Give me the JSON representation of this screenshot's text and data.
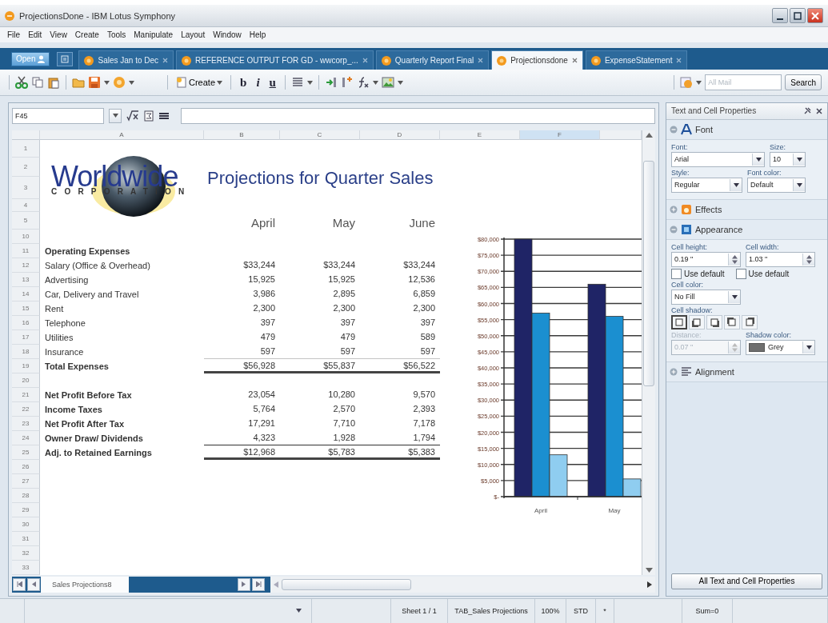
{
  "window": {
    "title": "ProjectionsDone - IBM Lotus Symphony"
  },
  "menu": [
    "File",
    "Edit",
    "View",
    "Create",
    "Tools",
    "Manipulate",
    "Layout",
    "Window",
    "Help"
  ],
  "open_button": {
    "label": "Open"
  },
  "tabs": [
    {
      "label": "Sales Jan to Dec",
      "selected": false
    },
    {
      "label": "REFERENCE OUTPUT FOR GD - wwcorp_...",
      "selected": false
    },
    {
      "label": "Quarterly Report Final",
      "selected": false
    },
    {
      "label": "Projectionsdone",
      "selected": true
    },
    {
      "label": "ExpenseStatement",
      "selected": false
    }
  ],
  "toolbar": {
    "create": "Create",
    "format_buttons": [
      "b",
      "i",
      "u"
    ],
    "search": {
      "placeholder": "All Mail",
      "button": "Search"
    }
  },
  "formula_bar": {
    "name_box": "F45"
  },
  "sheet": {
    "columns": [
      {
        "label": "A",
        "selected": false
      },
      {
        "label": "B",
        "selected": false
      },
      {
        "label": "C",
        "selected": false
      },
      {
        "label": "D",
        "selected": false
      },
      {
        "label": "E",
        "selected": false
      },
      {
        "label": "F",
        "selected": true
      }
    ],
    "header_rows": [
      "1",
      "2",
      "3",
      "4",
      "5"
    ],
    "logo": {
      "name": "Worldwide",
      "tagline": "CORPORATION"
    },
    "title": "Projections for Quarter Sales",
    "months": [
      "April",
      "May",
      "June"
    ],
    "rows": [
      {
        "number": "10"
      },
      {
        "number": "11",
        "label": "Operating Expenses",
        "kind": "heading"
      },
      {
        "number": "12",
        "label": "Salary (Office & Overhead)",
        "kind": "item",
        "values": [
          "$33,244",
          "$33,244",
          "$33,244"
        ]
      },
      {
        "number": "13",
        "label": "Advertising",
        "kind": "item",
        "values": [
          "15,925",
          "15,925",
          "12,536"
        ]
      },
      {
        "number": "14",
        "label": "Car, Delivery and Travel",
        "kind": "item",
        "values": [
          "3,986",
          "2,895",
          "6,859"
        ]
      },
      {
        "number": "15",
        "label": "Rent",
        "kind": "item",
        "values": [
          "2,300",
          "2,300",
          "2,300"
        ]
      },
      {
        "number": "16",
        "label": "Telephone",
        "kind": "item",
        "values": [
          "397",
          "397",
          "397"
        ]
      },
      {
        "number": "17",
        "label": "Utilities",
        "kind": "item",
        "values": [
          "479",
          "479",
          "589"
        ]
      },
      {
        "number": "18",
        "label": "Insurance",
        "kind": "lastitem",
        "values": [
          "597",
          "597",
          "597"
        ]
      },
      {
        "number": "19",
        "label": "Total Expenses",
        "kind": "total",
        "values": [
          "$56,928",
          "$55,837",
          "$56,522"
        ]
      },
      {
        "number": "20"
      },
      {
        "number": "21",
        "label": "Net Profit Before Tax",
        "kind": "bolditem",
        "values": [
          "23,054",
          "10,280",
          "9,570"
        ]
      },
      {
        "number": "22",
        "label": "Income Taxes",
        "kind": "bolditem",
        "values": [
          "5,764",
          "2,570",
          "2,393"
        ]
      },
      {
        "number": "23",
        "label": "Net Profit After Tax",
        "kind": "bolditem",
        "values": [
          "17,291",
          "7,710",
          "7,178"
        ]
      },
      {
        "number": "24",
        "label": "Owner Draw/ Dividends",
        "kind": "boldlast",
        "values": [
          "4,323",
          "1,928",
          "1,794"
        ]
      },
      {
        "number": "25",
        "label": "Adj. to Retained Earnings",
        "kind": "total",
        "values": [
          "$12,968",
          "$5,783",
          "$5,383"
        ]
      },
      {
        "number": "26"
      },
      {
        "number": "27"
      },
      {
        "number": "28"
      },
      {
        "number": "29"
      },
      {
        "number": "30"
      },
      {
        "number": "31"
      },
      {
        "number": "32"
      },
      {
        "number": "33"
      }
    ],
    "chart_data": {
      "type": "bar",
      "categories": [
        "April",
        "May"
      ],
      "series": [
        {
          "color": "#1f2466",
          "values": [
            80000,
            66000
          ]
        },
        {
          "color": "#1b8fd0",
          "values": [
            57000,
            56000
          ]
        },
        {
          "color": "#8fcdf0",
          "values": [
            13000,
            5500
          ]
        }
      ],
      "ylim": [
        0,
        80000
      ],
      "grid": true,
      "yticks": [
        {
          "value": 0,
          "label": "$-"
        },
        {
          "value": 5000,
          "label": "$5,000"
        },
        {
          "value": 10000,
          "label": "$10,000"
        },
        {
          "value": 15000,
          "label": "$15,000"
        },
        {
          "value": 20000,
          "label": "$20,000"
        },
        {
          "value": 25000,
          "label": "$25,000"
        },
        {
          "value": 30000,
          "label": "$30,000"
        },
        {
          "value": 35000,
          "label": "$35,000"
        },
        {
          "value": 40000,
          "label": "$40,000"
        },
        {
          "value": 45000,
          "label": "$45,000"
        },
        {
          "value": 50000,
          "label": "$50,000"
        },
        {
          "value": 55000,
          "label": "$55,000"
        },
        {
          "value": 60000,
          "label": "$60,000"
        },
        {
          "value": 65000,
          "label": "$65,000"
        },
        {
          "value": 70000,
          "label": "$70,000"
        },
        {
          "value": 75000,
          "label": "$75,000"
        },
        {
          "value": 80000,
          "label": "$80,000"
        }
      ]
    },
    "sheet_tab": {
      "label": "Sales Projections8",
      "selected": true
    }
  },
  "properties_panel": {
    "title": "Text and Cell Properties",
    "sections": [
      {
        "kind": "font",
        "title": "Font",
        "expanded": true,
        "font": {
          "label": "Font:",
          "value": "Arial"
        },
        "size": {
          "label": "Size:",
          "value": "10"
        },
        "style": {
          "label": "Style:",
          "value": "Regular"
        },
        "font_color": {
          "label": "Font color:",
          "value": "Default"
        }
      },
      {
        "kind": "effects",
        "title": "Effects",
        "expanded": false
      },
      {
        "kind": "appearance",
        "title": "Appearance",
        "expanded": true,
        "cell_height": {
          "label": "Cell height:",
          "value": "0.19 \""
        },
        "cell_width": {
          "label": "Cell width:",
          "value": "1.03 \""
        },
        "use_default": [
          {
            "label": "Use default",
            "checked": false
          },
          {
            "label": "Use default",
            "checked": false
          }
        ],
        "cell_color": {
          "label": "Cell color:",
          "value": "No Fill"
        },
        "cell_shadow": {
          "label": "Cell shadow:",
          "options": [
            {
              "selected": true
            },
            {
              "selected": false
            },
            {
              "selected": false
            },
            {
              "selected": false
            },
            {
              "selected": false
            }
          ]
        },
        "distance": {
          "label": "Distance:",
          "value": "0.07 \"",
          "disabled": true
        },
        "shadow_color": {
          "label": "Shadow color:",
          "value": "Grey"
        }
      },
      {
        "kind": "alignment",
        "title": "Alignment",
        "expanded": false
      }
    ],
    "button": "All Text and Cell Properties"
  },
  "status_bar": {
    "sheet": "Sheet 1 / 1",
    "tab": "TAB_Sales Projections",
    "zoom": "100%",
    "mode": "STD",
    "modified": "*",
    "sum": "Sum=0"
  }
}
